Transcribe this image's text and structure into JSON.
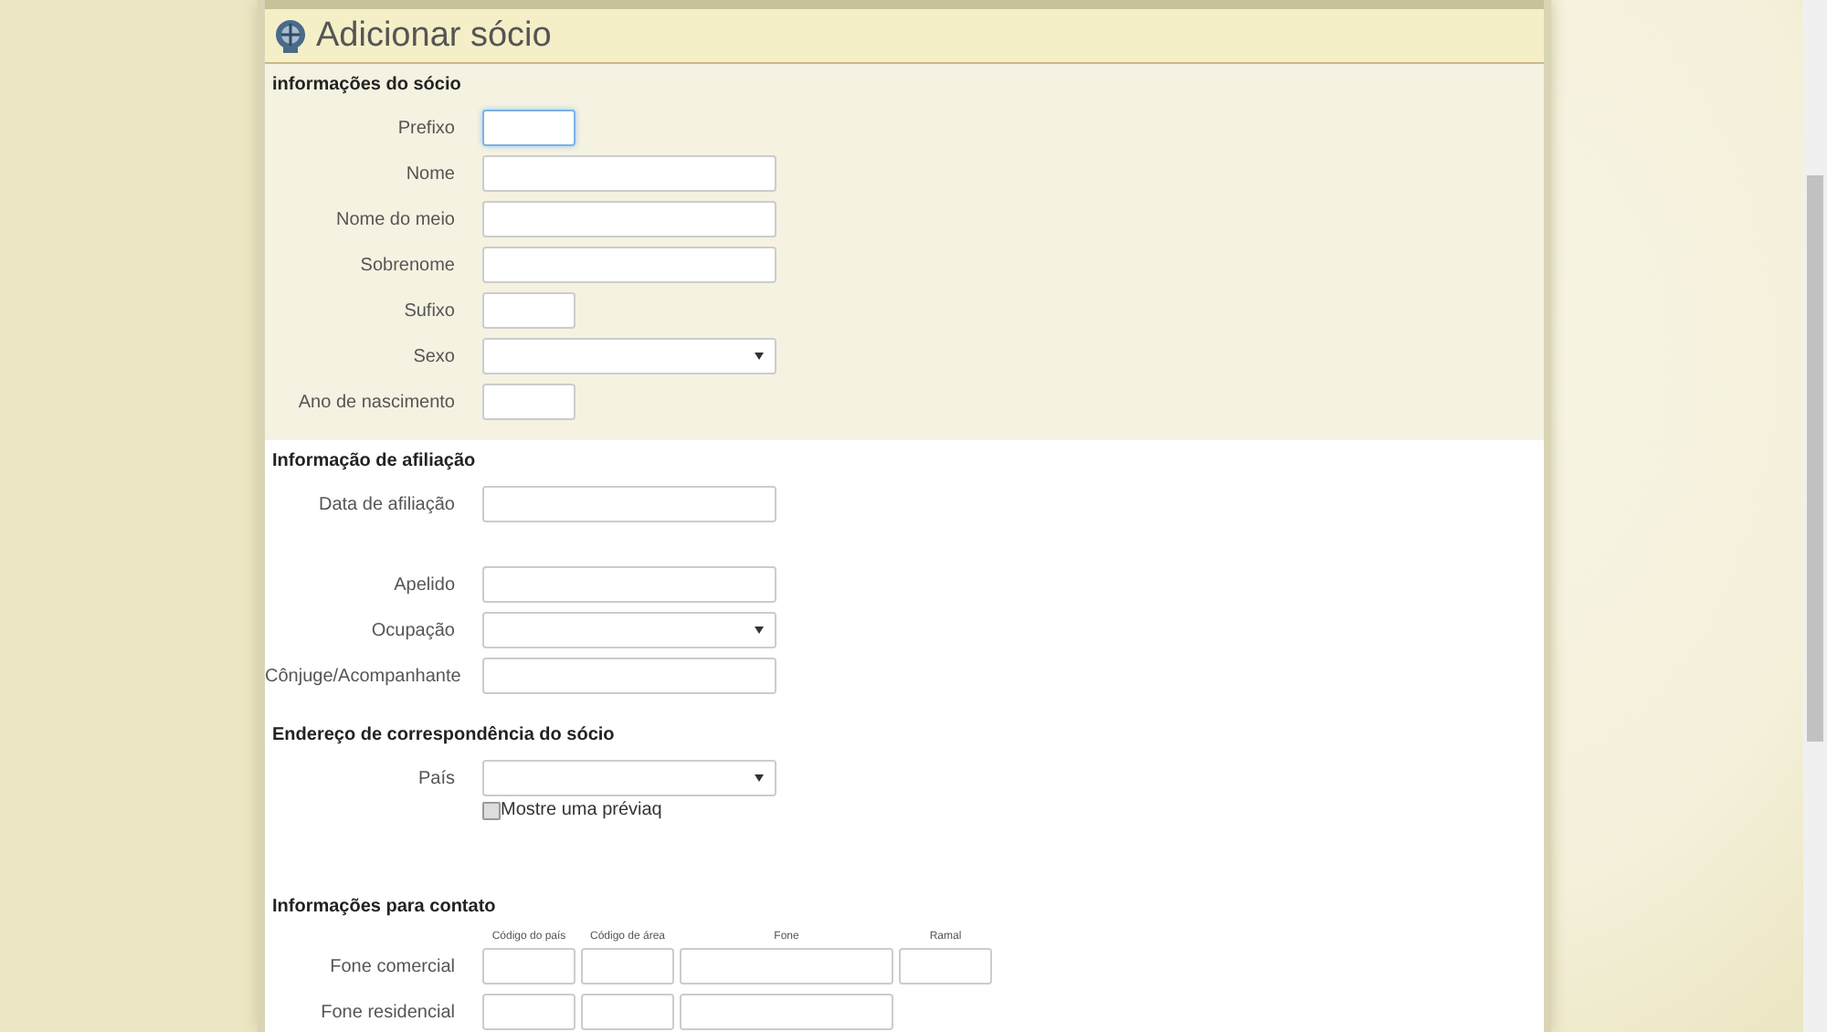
{
  "title": "Adicionar sócio",
  "sections": [
    {
      "heading": "informações do sócio",
      "shaded": true,
      "rows": [
        {
          "label": "Prefixo",
          "kind": "short",
          "focused": true
        },
        {
          "label": "Nome",
          "kind": "input",
          "focused": false
        },
        {
          "label": "Nome do meio",
          "kind": "input",
          "focused": false
        },
        {
          "label": "Sobrenome",
          "kind": "input",
          "focused": false
        },
        {
          "label": "Sufixo",
          "kind": "short",
          "focused": false
        },
        {
          "label": "Sexo",
          "kind": "select",
          "focused": false
        },
        {
          "label": "Ano de nascimento",
          "kind": "short",
          "focused": false
        }
      ]
    },
    {
      "heading": "Informação de afiliação",
      "shaded": false,
      "rows": [
        {
          "label": "Data de afiliação",
          "kind": "date",
          "focused": false
        },
        {
          "label": "Apelido",
          "kind": "input",
          "focused": false
        },
        {
          "label": "Ocupação",
          "kind": "select",
          "focused": false
        },
        {
          "label": "Cônjuge/Acompanhante",
          "kind": "input",
          "focused": false
        }
      ]
    },
    {
      "heading": "Endereço de correspondência do sócio",
      "shaded": false,
      "rows": [
        {
          "label": "País",
          "kind": "select",
          "focused": false
        },
        {
          "label": "Mostre uma préviaq",
          "kind": "checkbox",
          "checked": false
        }
      ]
    },
    {
      "heading": "Informações para contato",
      "shaded": false,
      "phone_columns": [
        "Código do país",
        "Código de área",
        "Fone",
        "Ramal"
      ],
      "rows": [
        {
          "label": "Fone comercial",
          "kind": "phone-ext"
        },
        {
          "label": "Fone residencial",
          "kind": "phone"
        }
      ]
    }
  ]
}
